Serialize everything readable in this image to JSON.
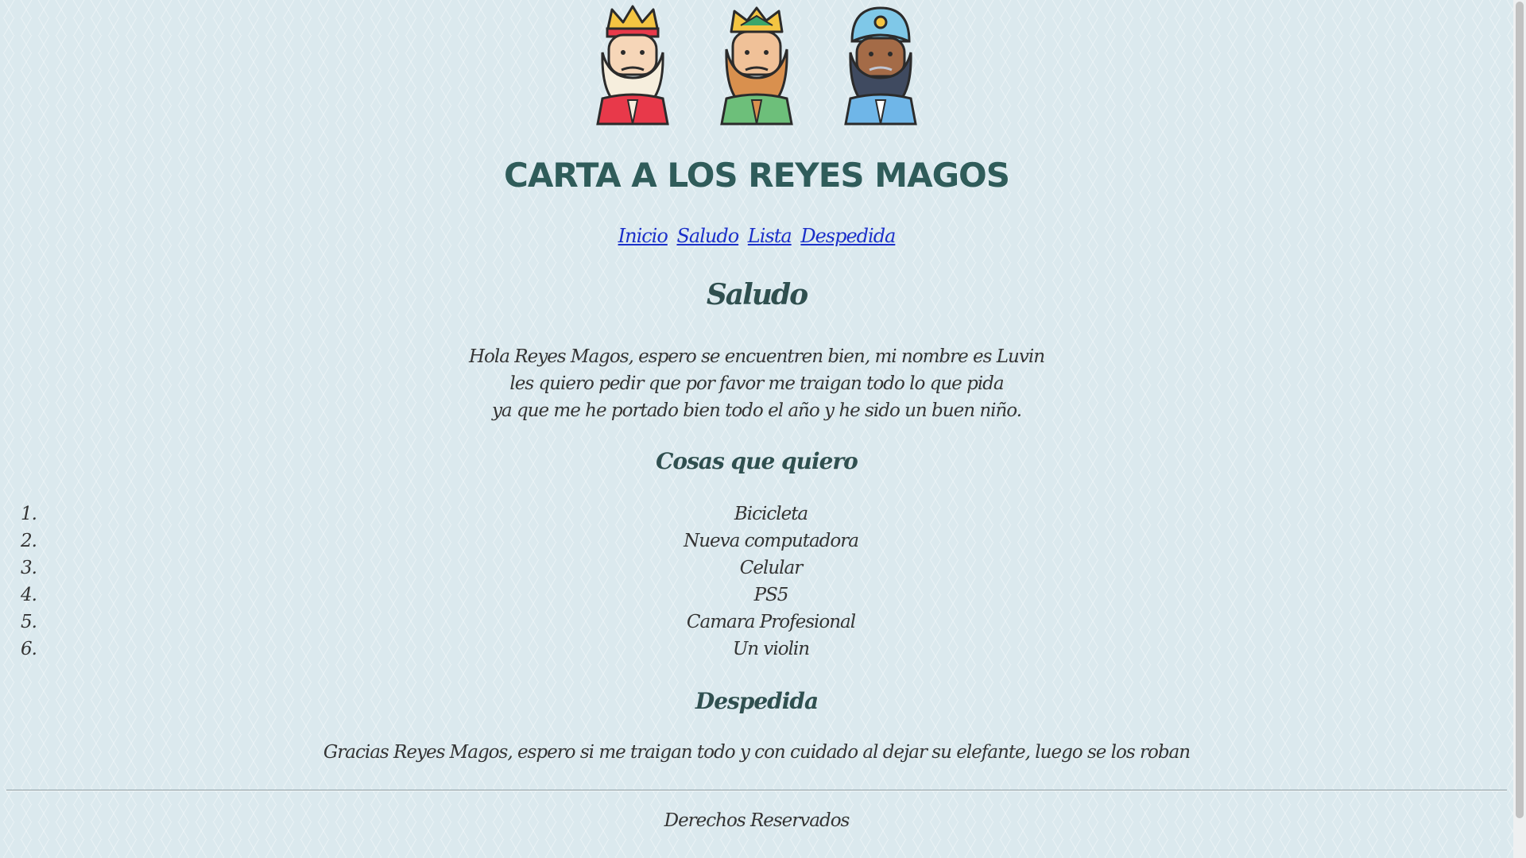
{
  "header": {
    "kings": [
      {
        "name": "king-melchor",
        "crown": "#f4c542",
        "beard": "#f6eedd",
        "skin": "#f6d6b8",
        "robe": "#e8394a"
      },
      {
        "name": "king-gaspar",
        "crown": "#f4c542",
        "beard": "#d9904e",
        "skin": "#f0c198",
        "robe": "#6dbf7a"
      },
      {
        "name": "king-baltasar",
        "crown": "#7fc8e8",
        "beard": "#3f4a60",
        "skin": "#a46b47",
        "robe": "#6fb6e8"
      }
    ],
    "title": "CARTA A LOS REYES MAGOS"
  },
  "nav": {
    "links": [
      "Inicio",
      "Saludo",
      "Lista",
      "Despedida"
    ]
  },
  "saludo": {
    "heading": "Saludo",
    "lines": [
      "Hola Reyes Magos, espero se encuentren bien, mi nombre es Luvin",
      "les quiero pedir que por favor me traigan todo lo que pida",
      "ya que me he portado bien todo el año y he sido un buen niño."
    ]
  },
  "lista": {
    "heading": "Cosas que quiero",
    "items": [
      {
        "num": "1.",
        "text": "Bicicleta"
      },
      {
        "num": "2.",
        "text": "Nueva computadora"
      },
      {
        "num": "3.",
        "text": "Celular"
      },
      {
        "num": "4.",
        "text": "PS5"
      },
      {
        "num": "5.",
        "text": "Camara Profesional"
      },
      {
        "num": "6.",
        "text": "Un violin"
      }
    ]
  },
  "despedida": {
    "heading": "Despedida",
    "text": "Gracias Reyes Magos, espero si me traigan todo y con cuidado al dejar su elefante, luego se los roban"
  },
  "footer": {
    "text": "Derechos Reservados"
  }
}
